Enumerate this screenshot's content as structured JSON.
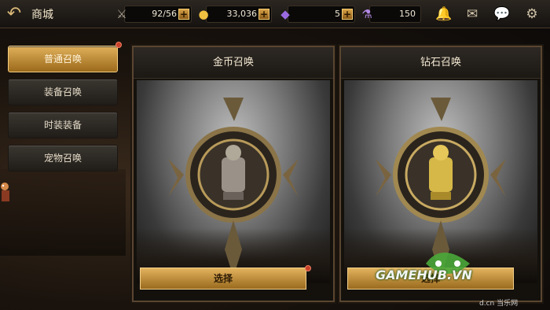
{
  "topbar": {
    "back_icon": "back-arrow-icon",
    "title": "商城",
    "resources": [
      {
        "icon": "stamina-icon",
        "value": "92/56"
      },
      {
        "icon": "gold-coin-icon",
        "value": "33,036"
      },
      {
        "icon": "diamond-icon",
        "value": "5"
      },
      {
        "icon": "potion-icon",
        "value": "150"
      }
    ],
    "right_icons": [
      "bell-icon",
      "mail-icon",
      "chat-icon",
      "settings-icon"
    ]
  },
  "menu": {
    "items": [
      {
        "label": "普通召唤",
        "active": true
      },
      {
        "label": "装备召唤",
        "active": false
      },
      {
        "label": "时装装备",
        "active": false
      },
      {
        "label": "宠物召唤",
        "active": false
      }
    ]
  },
  "cards": [
    {
      "title": "金币召唤",
      "button": "选择",
      "emblem": "bronze"
    },
    {
      "title": "钻石召唤",
      "button": "选择",
      "emblem": "gold"
    }
  ],
  "watermark": {
    "text": "GAMEHUB.VN",
    "sub": "d.cn 当乐网"
  },
  "colors": {
    "accent": "#d9a347",
    "badge": "#c8402a"
  }
}
